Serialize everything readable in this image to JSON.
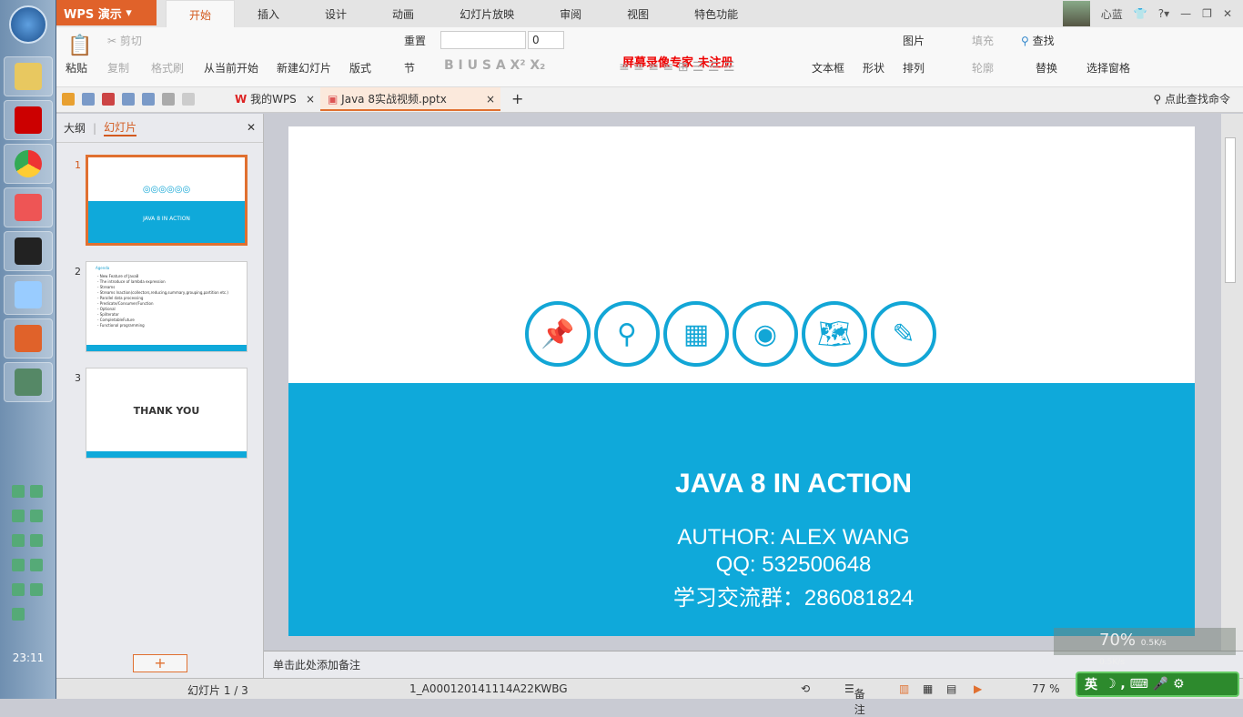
{
  "taskbar": {
    "clock": "23:11"
  },
  "titlebar": {
    "app_name": "WPS 演示",
    "tabs": [
      "开始",
      "插入",
      "设计",
      "动画",
      "幻灯片放映",
      "审阅",
      "视图",
      "特色功能"
    ],
    "active_tab": "开始",
    "user": "心蓝"
  },
  "ribbon": {
    "paste": "粘贴",
    "cut": "剪切",
    "copy": "复制",
    "format_painter": "格式刷",
    "play_from_current": "从当前开始",
    "new_slide": "新建幻灯片",
    "layout": "版式",
    "reset": "重置",
    "section": "节",
    "font_size": "0",
    "text_box": "文本框",
    "shape": "形状",
    "picture": "图片",
    "fill": "填充",
    "arrange": "排列",
    "outline": "轮廓",
    "find": "查找",
    "replace": "替换",
    "selection_pane": "选择窗格",
    "watermark": "屏幕录像专家 未注册"
  },
  "doc_tabs": [
    {
      "label": "我的WPS"
    },
    {
      "label": "Java 8实战视频.pptx"
    }
  ],
  "command_search": "点此查找命令",
  "panel": {
    "tabs": [
      "大纲",
      "幻灯片"
    ],
    "active": "幻灯片",
    "slides": [
      {
        "num": "1",
        "title": "JAVA 8 IN ACTION"
      },
      {
        "num": "2",
        "title": "Agenda",
        "items": [
          "New Feature of Java8",
          "The introduce of lambda expression",
          "Streams",
          "Streams Inaction(collectors,reducing,summary,grouping,partition etc.)",
          "Parallel data processing",
          "Predicate/Consumer/Function",
          "Optional",
          "Spliterator",
          "CompletableFuture",
          "Functional programming"
        ]
      },
      {
        "num": "3",
        "title": "THANK YOU"
      }
    ],
    "add": "+"
  },
  "slide": {
    "icons": [
      "pin-icon",
      "search-icon",
      "grid-icon",
      "eye-icon",
      "world-map-icon",
      "edit-icon"
    ],
    "title": "JAVA 8 IN ACTION",
    "author": "AUTHOR: ALEX WANG",
    "qq": "QQ: 532500648",
    "group": "学习交流群：286081824",
    "band_color": "#0fa9da"
  },
  "notes_placeholder": "单击此处添加备注",
  "status": {
    "slide_pos": "幻灯片 1 / 3",
    "template": "1_A000120141114A22KWBG",
    "notes": "备注",
    "zoom": "77 %"
  },
  "overlay": {
    "cpu": "70%",
    "up": "0.5K/s",
    "down": "0.5K/s",
    "ime": "英"
  }
}
